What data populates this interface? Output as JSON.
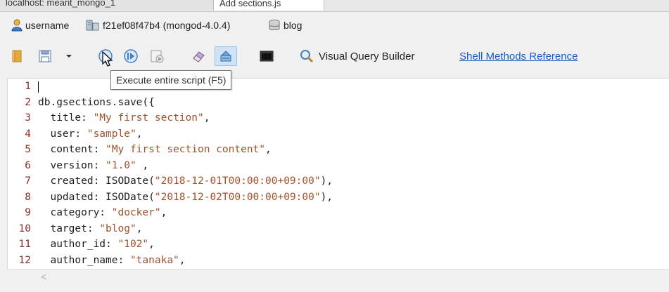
{
  "tabs": [
    "localhost: meant_mongo_1",
    "Add sections.js"
  ],
  "connection": {
    "user": "username",
    "host": "f21ef08f47b4 (mongod-4.0.4)",
    "database": "blog"
  },
  "toolbar": {
    "visual_query_builder": "Visual Query Builder",
    "shell_methods_reference": "Shell Methods Reference",
    "tooltip": "Execute entire script (F5)"
  },
  "editor": {
    "lines": [
      {
        "n": "1",
        "code": ""
      },
      {
        "n": "2",
        "code": "db.gsections.save({"
      },
      {
        "n": "3",
        "key": "  title: ",
        "str": "\"My first section\"",
        "tail": ","
      },
      {
        "n": "4",
        "key": "  user: ",
        "str": "\"sample\"",
        "tail": ","
      },
      {
        "n": "5",
        "key": "  content: ",
        "str": "\"My first section content\"",
        "tail": ","
      },
      {
        "n": "6",
        "key": "  version: ",
        "str": "\"1.0\"",
        "tail": " ,"
      },
      {
        "n": "7",
        "key": "  created: ISODate(",
        "str": "\"2018-12-01T00:00:00+09:00\"",
        "tail": "),"
      },
      {
        "n": "8",
        "key": "  updated: ISODate(",
        "str": "\"2018-12-02T00:00:00+09:00\"",
        "tail": "),"
      },
      {
        "n": "9",
        "key": "  category: ",
        "str": "\"docker\"",
        "tail": ","
      },
      {
        "n": "10",
        "key": "  target: ",
        "str": "\"blog\"",
        "tail": ","
      },
      {
        "n": "11",
        "key": "  author_id: ",
        "str": "\"102\"",
        "tail": ","
      },
      {
        "n": "12",
        "key": "  author_name: ",
        "str": "\"tanaka\"",
        "tail": ","
      }
    ]
  },
  "icons": {
    "user": "user-icon",
    "server": "server-icon",
    "database": "database-icon",
    "open": "open-folder-icon",
    "save": "save-icon",
    "run_all": "run-all-icon",
    "run_line": "run-line-icon",
    "step": "step-icon",
    "eraser": "clear-icon",
    "stop": "stop-icon",
    "shell": "shell-icon",
    "vqb": "magnifier-icon"
  },
  "colors": {
    "line_number": "#8b2e2e",
    "string": "#a0522d",
    "link": "#1a5cc4",
    "selected_button": "#cfe3f7"
  }
}
